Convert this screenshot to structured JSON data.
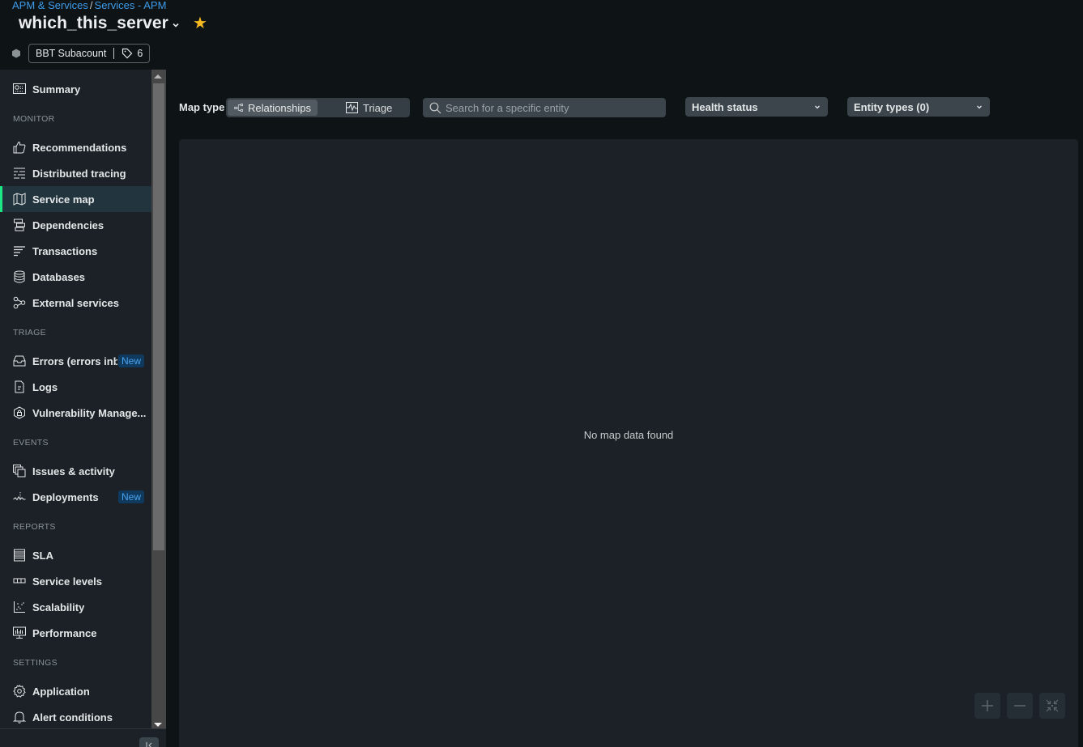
{
  "breadcrumb": {
    "items": [
      "APM & Services",
      "Services - APM"
    ],
    "separator": "/"
  },
  "header": {
    "title": "which_this_server",
    "favorited": true,
    "account_name": "BBT Subacount",
    "tag_count": "6"
  },
  "sidebar": {
    "summary": {
      "label": "Summary",
      "icon": "summary-icon"
    },
    "sections": [
      {
        "title": "MONITOR",
        "items": [
          {
            "label": "Recommendations",
            "icon": "thumbs-up-icon"
          },
          {
            "label": "Distributed tracing",
            "icon": "tracing-icon"
          },
          {
            "label": "Service map",
            "icon": "map-icon",
            "active": true
          },
          {
            "label": "Dependencies",
            "icon": "dependencies-icon"
          },
          {
            "label": "Transactions",
            "icon": "transactions-icon"
          },
          {
            "label": "Databases",
            "icon": "database-icon"
          },
          {
            "label": "External services",
            "icon": "external-services-icon"
          }
        ]
      },
      {
        "title": "TRIAGE",
        "items": [
          {
            "label": "Errors (errors inbox)",
            "icon": "inbox-icon",
            "badge": "New"
          },
          {
            "label": "Logs",
            "icon": "document-icon"
          },
          {
            "label": "Vulnerability Manage...",
            "icon": "shield-lock-icon"
          }
        ]
      },
      {
        "title": "EVENTS",
        "items": [
          {
            "label": "Issues & activity",
            "icon": "issues-icon"
          },
          {
            "label": "Deployments",
            "icon": "deployments-icon",
            "badge": "New"
          }
        ]
      },
      {
        "title": "REPORTS",
        "items": [
          {
            "label": "SLA",
            "icon": "sla-icon"
          },
          {
            "label": "Service levels",
            "icon": "service-levels-icon"
          },
          {
            "label": "Scalability",
            "icon": "scatter-icon"
          },
          {
            "label": "Performance",
            "icon": "monitor-chart-icon"
          }
        ]
      },
      {
        "title": "SETTINGS",
        "items": [
          {
            "label": "Application",
            "icon": "gear-icon"
          },
          {
            "label": "Alert conditions",
            "icon": "bell-icon"
          }
        ]
      }
    ]
  },
  "toolbar": {
    "map_type_label": "Map type",
    "map_types": [
      {
        "label": "Relationships",
        "active": true
      },
      {
        "label": "Triage",
        "active": false
      }
    ],
    "search_placeholder": "Search for a specific entity",
    "search_value": "",
    "health_status": "Health status",
    "entity_types": "Entity types (0)"
  },
  "map": {
    "empty_message": "No map data found",
    "controls": [
      "zoom-in",
      "zoom-out",
      "fit-to-screen"
    ]
  },
  "colors": {
    "accent": "#1ce783",
    "link": "#3d9be9",
    "star": "#f5b821",
    "badge_bg": "#0f3a5e",
    "badge_text": "#4aa3f0"
  }
}
